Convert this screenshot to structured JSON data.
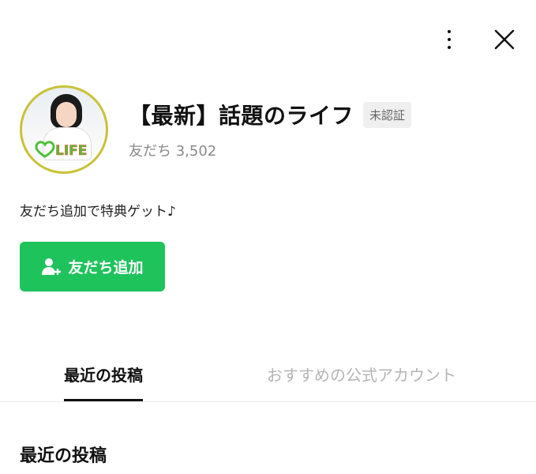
{
  "header": {
    "menu_icon": "more-vertical-icon",
    "close_icon": "close-icon"
  },
  "profile": {
    "name": "【最新】話題のライフ",
    "badge": "未認証",
    "friends": "友だち 3,502",
    "avatar_logo_text": "LIFE",
    "ring_color": "#c9c23a"
  },
  "description": "友だち追加で特典ゲット♪",
  "add_button": {
    "label": "友だち追加",
    "icon": "add-friend-icon",
    "color": "#1fc35c"
  },
  "tabs": [
    {
      "label": "最近の投稿",
      "active": true
    },
    {
      "label": "おすすめの公式アカウント",
      "active": false
    }
  ],
  "section": {
    "title": "最近の投稿"
  }
}
